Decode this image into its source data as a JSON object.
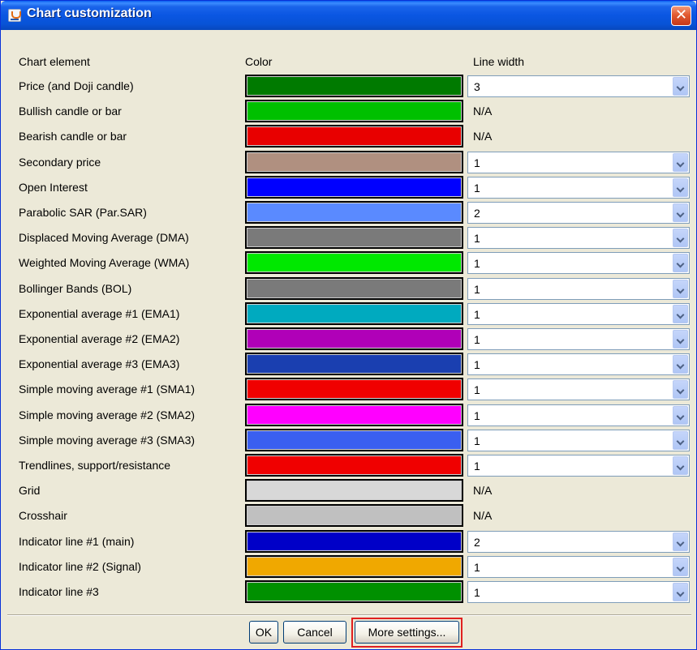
{
  "window": {
    "title": "Chart customization",
    "icon": "java-cup-icon",
    "close_icon": "close-icon"
  },
  "headers": {
    "element": "Chart element",
    "color": "Color",
    "line_width": "Line width"
  },
  "rows": [
    {
      "label": "Price (and Doji candle)",
      "color": "#007a00",
      "line_width": "3"
    },
    {
      "label": "Bullish candle or bar",
      "color": "#00c000",
      "line_width": "N/A"
    },
    {
      "label": "Bearish candle or bar",
      "color": "#e80000",
      "line_width": "N/A"
    },
    {
      "label": "Secondary price",
      "color": "#b09080",
      "line_width": "1"
    },
    {
      "label": "Open Interest",
      "color": "#0000ff",
      "line_width": "1"
    },
    {
      "label": "Parabolic SAR (Par.SAR)",
      "color": "#5a8aff",
      "line_width": "2"
    },
    {
      "label": "Displaced Moving Average (DMA)",
      "color": "#7a7a7a",
      "line_width": "1"
    },
    {
      "label": "Weighted Moving Average (WMA)",
      "color": "#00e800",
      "line_width": "1"
    },
    {
      "label": "Bollinger Bands (BOL)",
      "color": "#7a7a7a",
      "line_width": "1"
    },
    {
      "label": "Exponential average #1 (EMA1)",
      "color": "#00aabf",
      "line_width": "1"
    },
    {
      "label": "Exponential average #2 (EMA2)",
      "color": "#b000b8",
      "line_width": "1"
    },
    {
      "label": "Exponential average #3 (EMA3)",
      "color": "#1a3fb0",
      "line_width": "1"
    },
    {
      "label": "Simple moving average #1 (SMA1)",
      "color": "#f00000",
      "line_width": "1"
    },
    {
      "label": "Simple moving average #2 (SMA2)",
      "color": "#ff00ff",
      "line_width": "1"
    },
    {
      "label": "Simple moving average #3 (SMA3)",
      "color": "#3a5ff0",
      "line_width": "1"
    },
    {
      "label": "Trendlines, support/resistance",
      "color": "#f00000",
      "line_width": "1"
    },
    {
      "label": "Grid",
      "color": "#d8d8d8",
      "line_width": "N/A"
    },
    {
      "label": "Crosshair",
      "color": "#c0c0c0",
      "line_width": "N/A"
    },
    {
      "label": "Indicator line #1 (main)",
      "color": "#0000c8",
      "line_width": "2"
    },
    {
      "label": "Indicator line #2 (Signal)",
      "color": "#f0a800",
      "line_width": "1"
    },
    {
      "label": "Indicator line #3",
      "color": "#009000",
      "line_width": "1"
    }
  ],
  "buttons": {
    "ok": "OK",
    "cancel": "Cancel",
    "more": "More settings..."
  },
  "colors": {
    "title_bar": "#0a56e2",
    "dialog_background": "#ece9d8",
    "highlight_box": "#e02020"
  }
}
